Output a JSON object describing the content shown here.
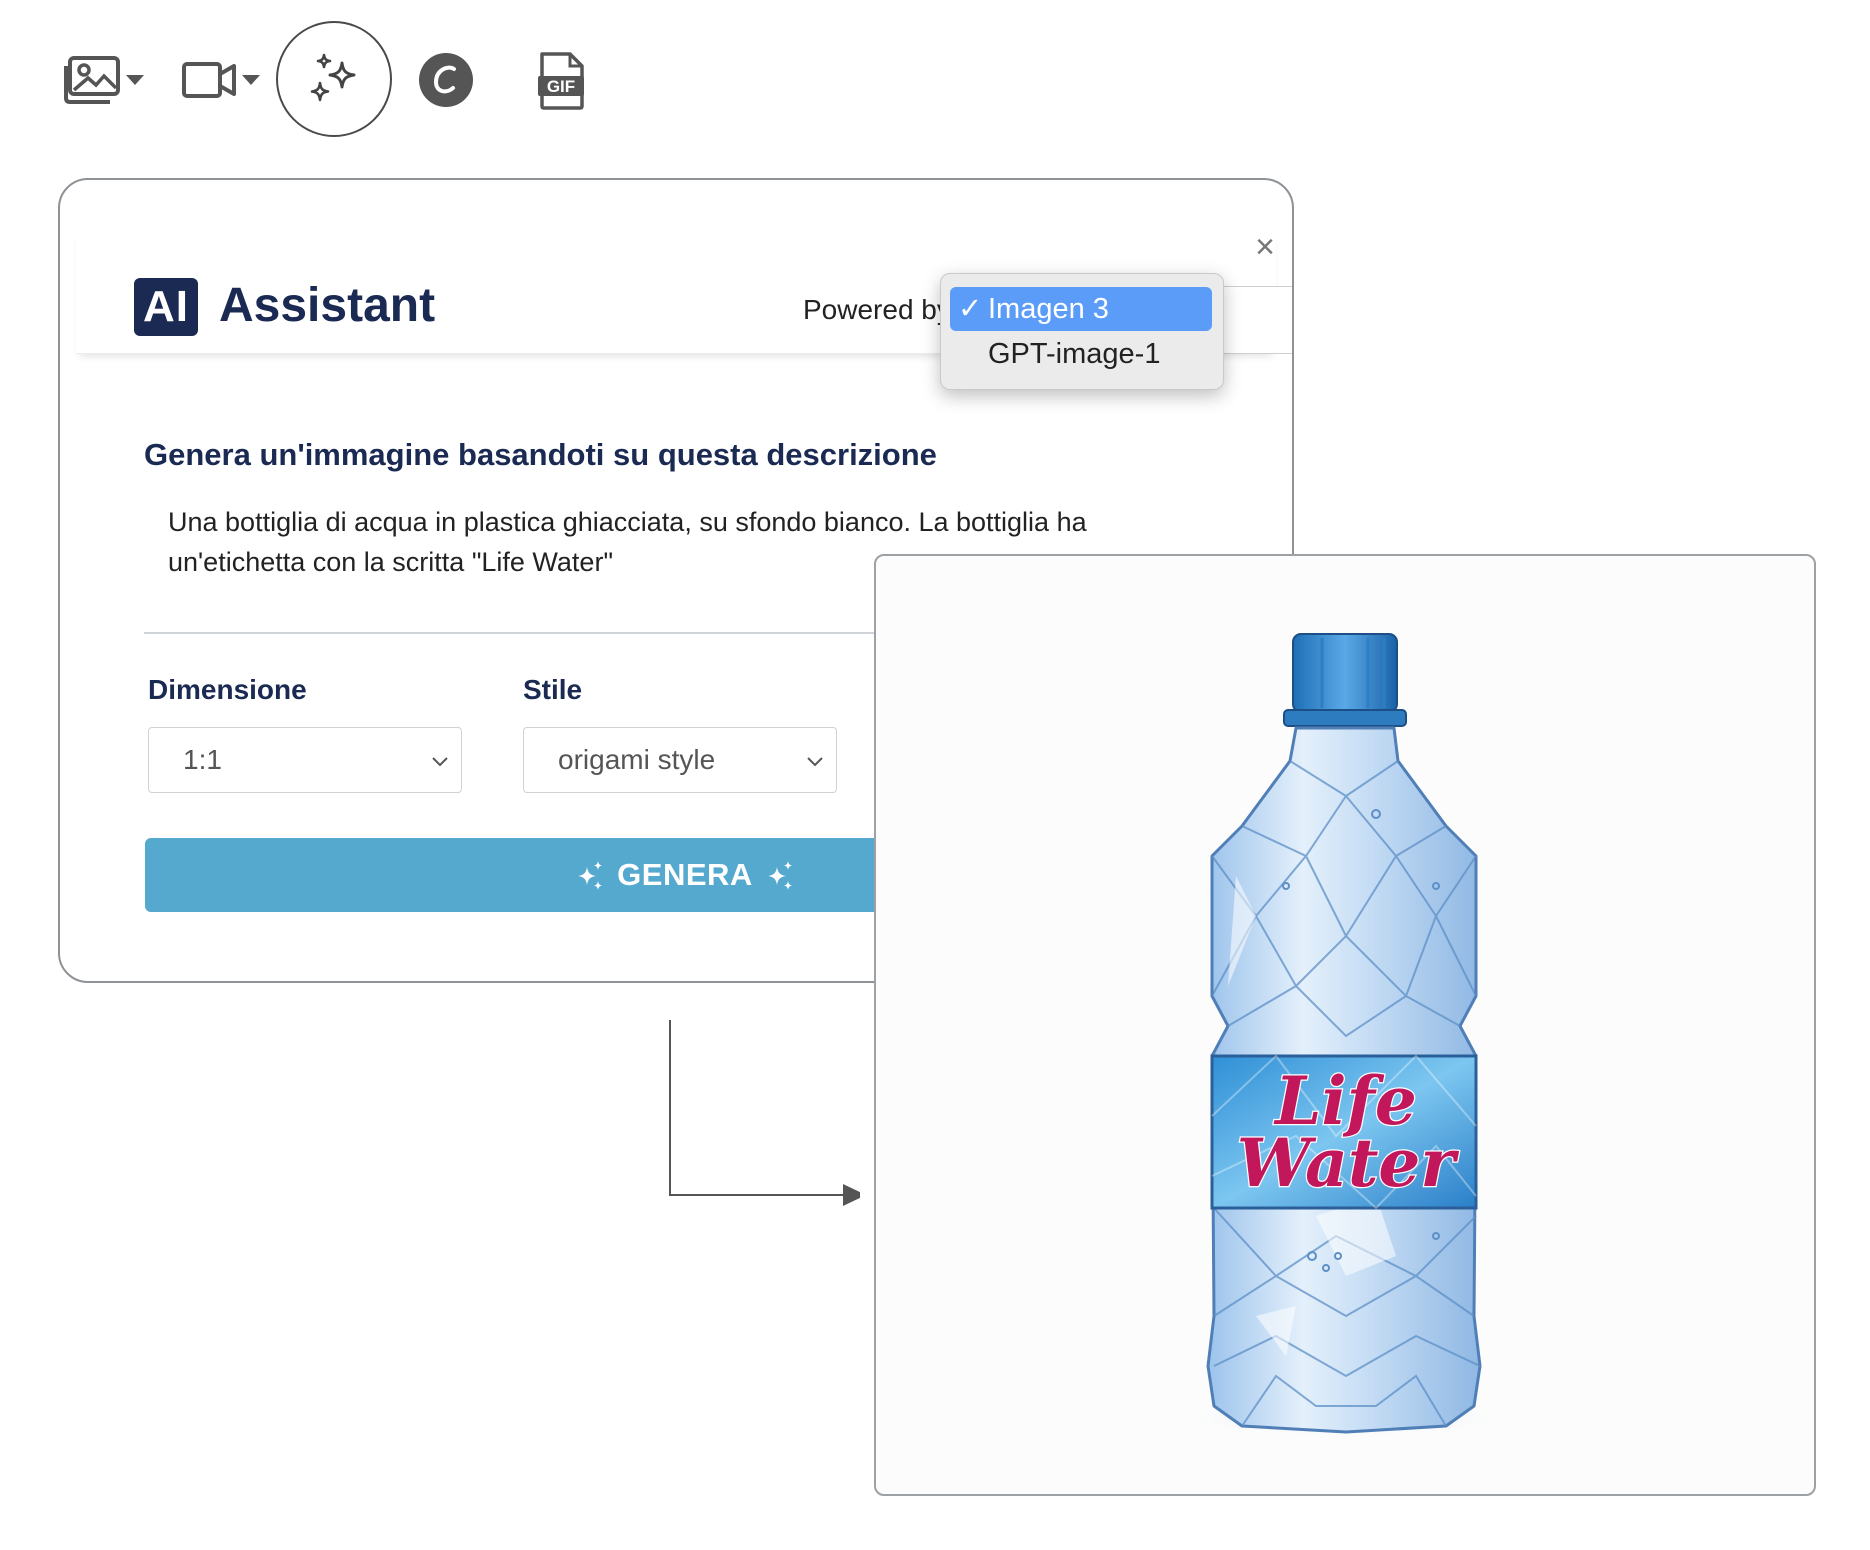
{
  "toolbar": {
    "buttons": [
      {
        "name": "image-dropdown",
        "icon": "image-icon"
      },
      {
        "name": "video-dropdown",
        "icon": "video-icon"
      },
      {
        "name": "ai-assistant",
        "icon": "sparkles-icon",
        "active": true
      },
      {
        "name": "canva",
        "icon": "canva-icon"
      },
      {
        "name": "gif",
        "icon": "gif-icon",
        "label": "GIF"
      }
    ]
  },
  "modal": {
    "badge": "AI",
    "title": "Assistant",
    "powered_by_label": "Powered by",
    "close_icon": "close-icon",
    "heading": "Genera un'immagine basandoti su questa descrizione",
    "prompt": "Una bottiglia di acqua in plastica ghiacciata, su sfondo bianco. La bottiglia ha un'etichetta con la scritta \"Life Water\"",
    "dimension": {
      "label": "Dimensione",
      "value": "1:1"
    },
    "style": {
      "label": "Stile",
      "value": "origami style"
    },
    "generate_button": "GENERA"
  },
  "dropdown": {
    "options": [
      {
        "label": "Imagen 3",
        "selected": true,
        "check": "✓"
      },
      {
        "label": "GPT-image-1",
        "selected": false
      }
    ]
  },
  "result": {
    "image_subject": "water-bottle",
    "label_line1": "Life",
    "label_line2": "Water"
  },
  "colors": {
    "brand_dark": "#1a2a52",
    "button": "#55a9cf",
    "selection": "#5b9cf9",
    "label_text": "#c2185b"
  }
}
